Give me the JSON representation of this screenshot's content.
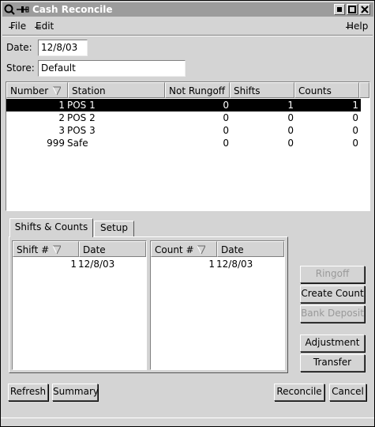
{
  "window": {
    "title": "Cash Reconcile"
  },
  "menu": {
    "file": "File",
    "edit": "Edit",
    "help": "Help"
  },
  "form": {
    "date_label": "Date:",
    "date_value": "12/8/03",
    "store_label": "Store:",
    "store_value": "Default"
  },
  "stations_table": {
    "headers": [
      "Number",
      "Station",
      "Not Rungoff",
      "Shifts",
      "Counts"
    ],
    "rows": [
      {
        "number": "1",
        "station": "POS 1",
        "not_rungoff": "0",
        "shifts": "1",
        "counts": "1",
        "selected": true
      },
      {
        "number": "2",
        "station": "POS 2",
        "not_rungoff": "0",
        "shifts": "0",
        "counts": "0",
        "selected": false
      },
      {
        "number": "3",
        "station": "POS 3",
        "not_rungoff": "0",
        "shifts": "0",
        "counts": "0",
        "selected": false
      },
      {
        "number": "999",
        "station": "Safe",
        "not_rungoff": "0",
        "shifts": "0",
        "counts": "0",
        "selected": false
      }
    ]
  },
  "tabs": {
    "shifts_counts": "Shifts & Counts",
    "setup": "Setup"
  },
  "shifts_table": {
    "headers": [
      "Shift #",
      "Date"
    ],
    "rows": [
      {
        "num": "1",
        "date": "12/8/03"
      }
    ]
  },
  "counts_table": {
    "headers": [
      "Count #",
      "Date"
    ],
    "rows": [
      {
        "num": "1",
        "date": "12/8/03"
      }
    ]
  },
  "side_buttons": {
    "ringoff": "Ringoff",
    "create_count": "Create Count",
    "bank_deposit": "Bank Deposit",
    "adjustment": "Adjustment",
    "transfer": "Transfer"
  },
  "bottom_buttons": {
    "refresh": "Refresh",
    "summary": "Summary",
    "reconcile": "Reconcile",
    "cancel": "Cancel"
  }
}
